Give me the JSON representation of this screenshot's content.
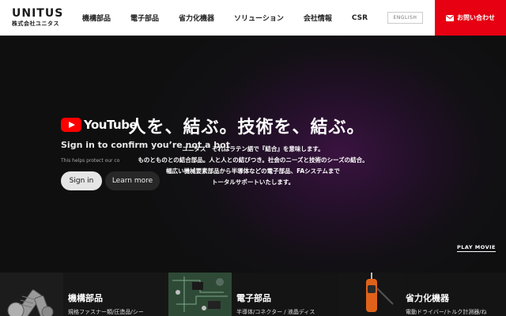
{
  "header": {
    "logo_main": "UNITUS",
    "logo_sub": "株式会社ユニタス",
    "nav": [
      "機構部品",
      "電子部品",
      "省力化機器",
      "ソリューション",
      "会社情報",
      "CSR"
    ],
    "lang_label": "ENGLISH",
    "contact_label": "お問い合わせ",
    "accent_color": "#e60012"
  },
  "youtube_overlay": {
    "logo_text": "YouTube",
    "title": "Sign in to confirm you’re not a bot",
    "help": "This helps protect our co",
    "signin_label": "Sign in",
    "learn_label": "Learn more"
  },
  "hero": {
    "headline": "人を、結ぶ。技術を、結ぶ。",
    "lines": [
      "ユニタス　それはラテン語で『結合』を意味します。",
      "ものとものとの結合部品。人と人との結びつき。社会のニーズと技術のシーズの結合。",
      "幅広い機械要素部品から半導体などの電子部品、FAシステムまで",
      "トータルサポートいたします。"
    ],
    "play_label": "PLAY MOVIE"
  },
  "categories": [
    {
      "title": "機構部品",
      "sub": "規格ファスナー類/圧造品/シー",
      "icon": "bolts-photo"
    },
    {
      "title": "電子部品",
      "sub": "半導体/コネクター / 液晶ディス",
      "icon": "circuit-board-photo"
    },
    {
      "title": "省力化機器",
      "sub": "電動ドライバー/トルク計測器/ね",
      "icon": "electric-screwdriver-photo"
    }
  ]
}
